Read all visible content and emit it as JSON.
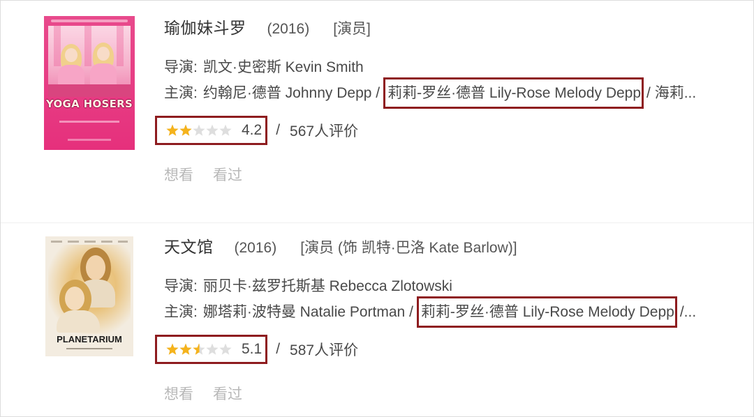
{
  "colors": {
    "highlight_box": "#8e1c1f",
    "star_filled": "#f5b31c",
    "star_empty": "#dedede"
  },
  "icons": {
    "rating_star": "star-icon"
  },
  "entries": [
    {
      "poster_text": "YOGA HOSERS",
      "title": "瑜伽妹斗罗",
      "year": "(2016)",
      "role": "[演员]",
      "director_label": "导演:",
      "director": "凯文·史密斯 Kevin Smith",
      "cast_label": "主演:",
      "cast_before": "约翰尼·德普 Johnny Depp /",
      "cast_highlight": "莉莉-罗丝·德普 Lily-Rose Melody Depp",
      "cast_after": "/ 海莉...",
      "stars": 2,
      "rating": "4.2",
      "rating_sep": "/",
      "rating_count": "567人评价",
      "want": "想看",
      "seen": "看过"
    },
    {
      "poster_text": "PLANETARIUM",
      "title": "天文馆",
      "year": "(2016)",
      "role": "[演员 (饰 凯特·巴洛 Kate Barlow)]",
      "director_label": "导演:",
      "director": "丽贝卡·兹罗托斯基 Rebecca Zlotowski",
      "cast_label": "主演:",
      "cast_before": "娜塔莉·波特曼 Natalie Portman /",
      "cast_highlight": "莉莉-罗丝·德普 Lily-Rose Melody Depp",
      "cast_after": "/...",
      "stars": 2.5,
      "rating": "5.1",
      "rating_sep": "/",
      "rating_count": "587人评价",
      "want": "想看",
      "seen": "看过"
    }
  ]
}
